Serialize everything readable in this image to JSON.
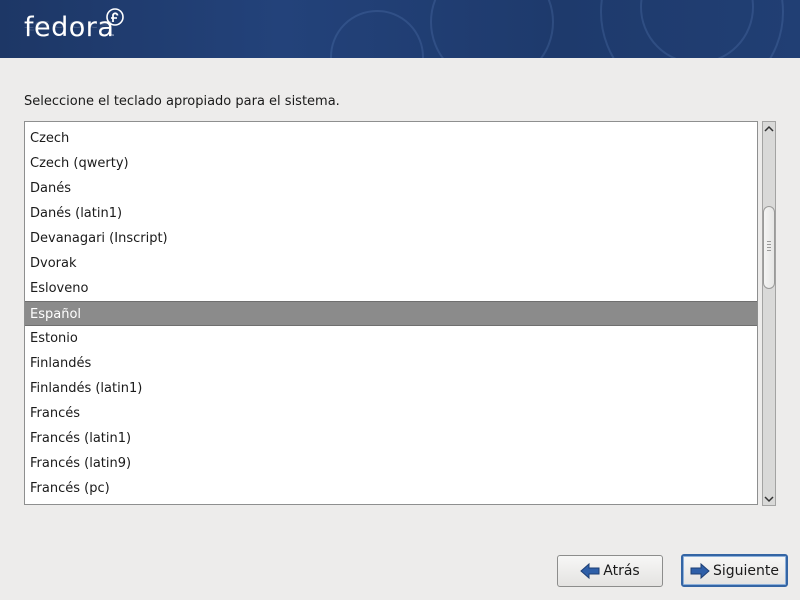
{
  "header": {
    "logo_text": "fedora",
    "logo_tm": "™"
  },
  "prompt": "Seleccione el teclado apropiado para el sistema.",
  "keyboard_list": {
    "items": [
      "Czech",
      "Czech (qwerty)",
      "Danés",
      "Danés (latin1)",
      "Devanagari (Inscript)",
      "Dvorak",
      "Esloveno",
      "Español",
      "Estonio",
      "Finlandés",
      "Finlandés (latin1)",
      "Francés",
      "Francés (latin1)",
      "Francés (latin9)",
      "Francés (pc)"
    ],
    "selected": "Español"
  },
  "buttons": {
    "back_label": "Atrás",
    "next_label": "Siguiente"
  },
  "icons": {
    "scroll_up": "chevron-up-icon",
    "scroll_down": "chevron-down-icon",
    "back": "arrow-left-icon",
    "next": "arrow-right-icon"
  },
  "colors": {
    "banner": "#23427a",
    "selection": "#8b8b8b",
    "arrow_icon": "#2e5fa8",
    "default_button_border": "#3465a4"
  }
}
